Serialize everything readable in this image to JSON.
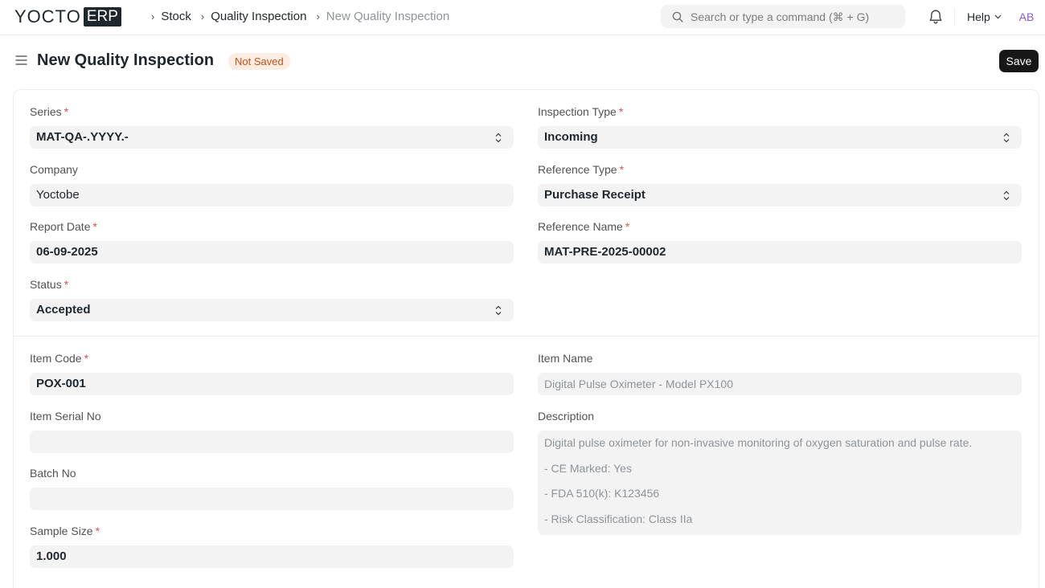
{
  "brand": {
    "logo_text": "YOCTO",
    "logo_badge": "ERP"
  },
  "breadcrumbs": [
    {
      "label": "Stock"
    },
    {
      "label": "Quality Inspection"
    },
    {
      "label": "New Quality Inspection"
    }
  ],
  "search": {
    "placeholder": "Search or type a command (⌘ + G)"
  },
  "nav": {
    "help_label": "Help",
    "avatar_initials": "AB"
  },
  "header": {
    "title": "New Quality Inspection",
    "status_badge": "Not Saved",
    "save_label": "Save"
  },
  "form": {
    "series": {
      "label": "Series",
      "value": "MAT-QA-.YYYY.-"
    },
    "company": {
      "label": "Company",
      "value": "Yoctobe"
    },
    "report_date": {
      "label": "Report Date",
      "value": "06-09-2025"
    },
    "status": {
      "label": "Status",
      "value": "Accepted"
    },
    "inspection_type": {
      "label": "Inspection Type",
      "value": "Incoming"
    },
    "reference_type": {
      "label": "Reference Type",
      "value": "Purchase Receipt"
    },
    "reference_name": {
      "label": "Reference Name",
      "value": "MAT-PRE-2025-00002"
    },
    "item_code": {
      "label": "Item Code",
      "value": "POX-001"
    },
    "item_serial_no": {
      "label": "Item Serial No",
      "value": ""
    },
    "batch_no": {
      "label": "Batch No",
      "value": ""
    },
    "sample_size": {
      "label": "Sample Size",
      "value": "1.000"
    },
    "item_name": {
      "label": "Item Name",
      "value": "Digital Pulse Oximeter - Model PX100"
    },
    "description": {
      "label": "Description",
      "lines": [
        "Digital pulse oximeter for non-invasive monitoring of oxygen saturation and pulse rate.",
        "- CE Marked: Yes",
        "- FDA 510(k): K123456",
        "- Risk Classification: Class IIa"
      ]
    },
    "required_marker": "*"
  },
  "colors": {
    "accent": "#171717",
    "required": "#e24c4c",
    "badge_bg": "#fdece1",
    "badge_text": "#c4511b",
    "avatar": "#8b5bd6"
  }
}
